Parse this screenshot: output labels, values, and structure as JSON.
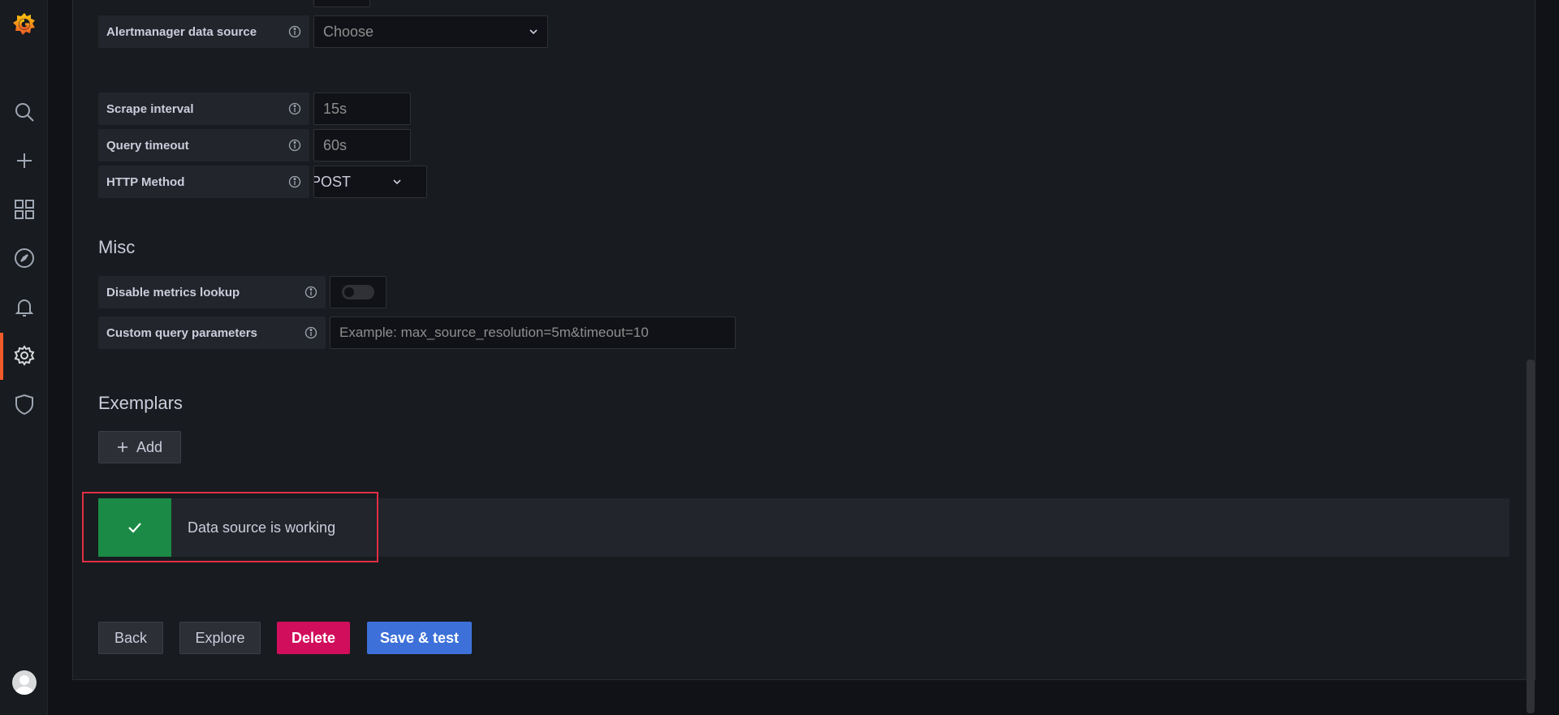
{
  "sidebar": {
    "items": [
      {
        "icon": "search-icon"
      },
      {
        "icon": "plus-icon"
      },
      {
        "icon": "dashboards-icon"
      },
      {
        "icon": "compass-icon"
      },
      {
        "icon": "bell-icon"
      },
      {
        "icon": "gear-icon",
        "active": true
      },
      {
        "icon": "shield-icon"
      }
    ]
  },
  "alerting": {
    "alertmanager_label": "Alertmanager data source",
    "alertmanager_placeholder": "Choose"
  },
  "http": {
    "scrape_interval_label": "Scrape interval",
    "scrape_interval_placeholder": "15s",
    "query_timeout_label": "Query timeout",
    "query_timeout_placeholder": "60s",
    "http_method_label": "HTTP Method",
    "http_method_value": "POST"
  },
  "misc": {
    "title": "Misc",
    "disable_metrics_label": "Disable metrics lookup",
    "disable_metrics_enabled": false,
    "custom_query_label": "Custom query parameters",
    "custom_query_placeholder": "Example: max_source_resolution=5m&timeout=10"
  },
  "exemplars": {
    "title": "Exemplars",
    "add_label": "Add"
  },
  "alert": {
    "message": "Data source is working",
    "status_color": "#1b8a46"
  },
  "actions": {
    "back": "Back",
    "explore": "Explore",
    "delete": "Delete",
    "save_test": "Save & test"
  },
  "colors": {
    "accent": "#f05a28",
    "danger": "#d10e5c",
    "primary": "#3d71d9",
    "highlight": "#e02f44"
  }
}
